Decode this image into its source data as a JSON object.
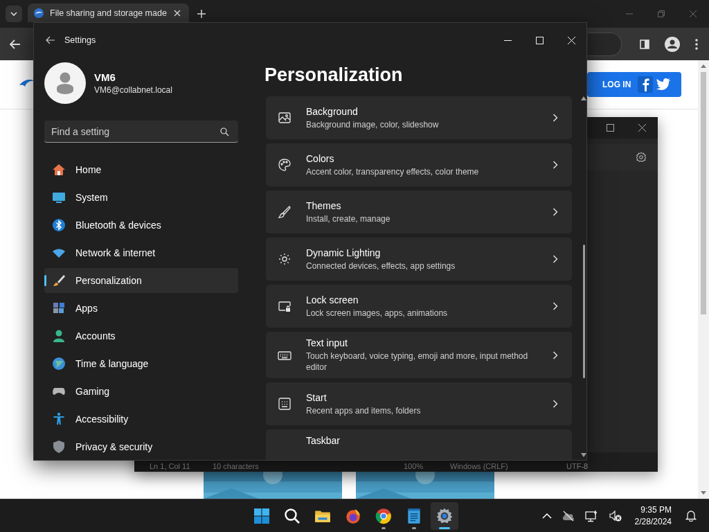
{
  "browser": {
    "tab": {
      "title": "File sharing and storage made",
      "selected": true
    },
    "login_button": "LOG IN"
  },
  "notepad": {
    "status_bar": [
      "Ln 1, Col 11",
      "10 characters",
      "100%",
      "Windows (CRLF)",
      "UTF-8"
    ]
  },
  "settings": {
    "title": "Settings",
    "user": {
      "name": "VM6",
      "email": "VM6@collabnet.local"
    },
    "search": {
      "placeholder": "Find a setting"
    },
    "nav": [
      {
        "label": "Home",
        "selected": false
      },
      {
        "label": "System",
        "selected": false
      },
      {
        "label": "Bluetooth & devices",
        "selected": false
      },
      {
        "label": "Network & internet",
        "selected": false
      },
      {
        "label": "Personalization",
        "selected": true
      },
      {
        "label": "Apps",
        "selected": false
      },
      {
        "label": "Accounts",
        "selected": false
      },
      {
        "label": "Time & language",
        "selected": false
      },
      {
        "label": "Gaming",
        "selected": false
      },
      {
        "label": "Accessibility",
        "selected": false
      },
      {
        "label": "Privacy & security",
        "selected": false
      }
    ],
    "heading": "Personalization",
    "cards": [
      {
        "title": "Background",
        "subtitle": "Background image, color, slideshow"
      },
      {
        "title": "Colors",
        "subtitle": "Accent color, transparency effects, color theme"
      },
      {
        "title": "Themes",
        "subtitle": "Install, create, manage"
      },
      {
        "title": "Dynamic Lighting",
        "subtitle": "Connected devices, effects, app settings"
      },
      {
        "title": "Lock screen",
        "subtitle": "Lock screen images, apps, animations"
      },
      {
        "title": "Text input",
        "subtitle": "Touch keyboard, voice typing, emoji and more, input method editor"
      },
      {
        "title": "Start",
        "subtitle": "Recent apps and items, folders"
      },
      {
        "title": "Taskbar"
      }
    ]
  },
  "taskbar": {
    "apps": [
      {
        "running": false,
        "active": false
      },
      {
        "running": false,
        "active": false
      },
      {
        "running": true,
        "active": false
      },
      {
        "running": true,
        "active": false
      },
      {
        "running": true,
        "active": true
      }
    ],
    "time": "9:35 PM",
    "date": "2/28/2024"
  }
}
